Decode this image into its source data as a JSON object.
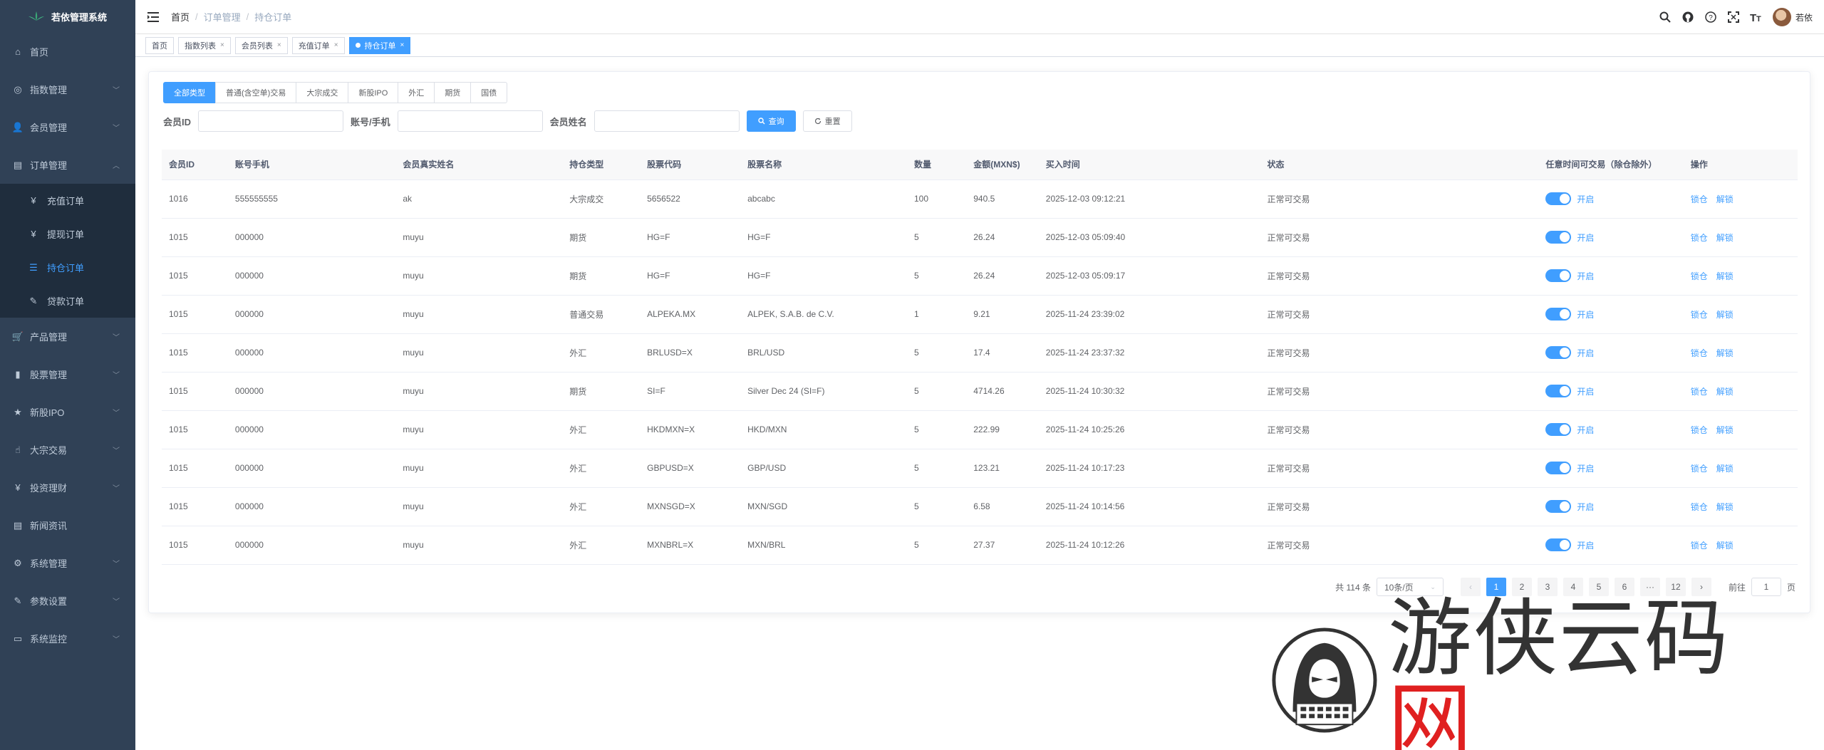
{
  "app": {
    "title": "若依管理系统"
  },
  "sidebar": {
    "items": [
      {
        "label": "首页",
        "icon": "dashboard-icon",
        "glyph": "⌂",
        "has_children": false
      },
      {
        "label": "指数管理",
        "icon": "index-icon",
        "glyph": "◎",
        "has_children": true
      },
      {
        "label": "会员管理",
        "icon": "user-icon",
        "glyph": "👤",
        "has_children": true
      },
      {
        "label": "订单管理",
        "icon": "order-icon",
        "glyph": "▤",
        "has_children": true,
        "expanded": true,
        "children": [
          {
            "label": "充值订单",
            "icon": "yen-icon",
            "glyph": "¥"
          },
          {
            "label": "提现订单",
            "icon": "yen-icon",
            "glyph": "¥"
          },
          {
            "label": "持仓订单",
            "icon": "list-icon",
            "glyph": "☰",
            "active": true
          },
          {
            "label": "贷款订单",
            "icon": "edit-icon",
            "glyph": "✎"
          }
        ]
      },
      {
        "label": "产品管理",
        "icon": "cart-icon",
        "glyph": "🛒",
        "has_children": true
      },
      {
        "label": "股票管理",
        "icon": "chart-icon",
        "glyph": "▮",
        "has_children": true
      },
      {
        "label": "新股IPO",
        "icon": "star-icon",
        "glyph": "★",
        "has_children": true
      },
      {
        "label": "大宗交易",
        "icon": "thumb-icon",
        "glyph": "☝",
        "has_children": true
      },
      {
        "label": "投资理财",
        "icon": "yen-icon",
        "glyph": "¥",
        "has_children": true
      },
      {
        "label": "新闻资讯",
        "icon": "news-icon",
        "glyph": "▤",
        "has_children": false
      },
      {
        "label": "系统管理",
        "icon": "gear-icon",
        "glyph": "⚙",
        "has_children": true
      },
      {
        "label": "参数设置",
        "icon": "edit-icon",
        "glyph": "✎",
        "has_children": true
      },
      {
        "label": "系统监控",
        "icon": "monitor-icon",
        "glyph": "▭",
        "has_children": true
      }
    ]
  },
  "breadcrumb": [
    "首页",
    "订单管理",
    "持仓订单"
  ],
  "navbar": {
    "username": "若依"
  },
  "tags": [
    {
      "label": "首页",
      "closable": false,
      "active": false
    },
    {
      "label": "指数列表",
      "closable": true,
      "active": false
    },
    {
      "label": "会员列表",
      "closable": true,
      "active": false
    },
    {
      "label": "充值订单",
      "closable": true,
      "active": false
    },
    {
      "label": "持仓订单",
      "closable": true,
      "active": true
    }
  ],
  "type_tabs": [
    "全部类型",
    "普通(含空单)交易",
    "大宗成交",
    "新股IPO",
    "外汇",
    "期货",
    "国债"
  ],
  "filters": {
    "member_id_label": "会员ID",
    "account_label": "账号/手机",
    "name_label": "会员姓名",
    "search_btn": "查询",
    "reset_btn": "重置"
  },
  "table": {
    "headers": [
      "会员ID",
      "账号手机",
      "会员真实姓名",
      "持仓类型",
      "股票代码",
      "股票名称",
      "数量",
      "金额(MXN$)",
      "买入时间",
      "状态",
      "任意时间可交易（除仓除外）",
      "操作"
    ],
    "switch_label": "开启",
    "op_close": "锁仓",
    "op_unlock": "解锁",
    "rows": [
      [
        "1016",
        "555555555",
        "ak",
        "大宗成交",
        "5656522",
        "abcabc",
        "100",
        "940.5",
        "2025-12-03 09:12:21",
        "正常可交易"
      ],
      [
        "1015",
        "000000",
        "muyu",
        "期货",
        "HG=F",
        "HG=F",
        "5",
        "26.24",
        "2025-12-03 05:09:40",
        "正常可交易"
      ],
      [
        "1015",
        "000000",
        "muyu",
        "期货",
        "HG=F",
        "HG=F",
        "5",
        "26.24",
        "2025-12-03 05:09:17",
        "正常可交易"
      ],
      [
        "1015",
        "000000",
        "muyu",
        "普通交易",
        "ALPEKA.MX",
        "ALPEK, S.A.B. de C.V.",
        "1",
        "9.21",
        "2025-11-24 23:39:02",
        "正常可交易"
      ],
      [
        "1015",
        "000000",
        "muyu",
        "外汇",
        "BRLUSD=X",
        "BRL/USD",
        "5",
        "17.4",
        "2025-11-24 23:37:32",
        "正常可交易"
      ],
      [
        "1015",
        "000000",
        "muyu",
        "期货",
        "SI=F",
        "Silver Dec 24 (SI=F)",
        "5",
        "4714.26",
        "2025-11-24 10:30:32",
        "正常可交易"
      ],
      [
        "1015",
        "000000",
        "muyu",
        "外汇",
        "HKDMXN=X",
        "HKD/MXN",
        "5",
        "222.99",
        "2025-11-24 10:25:26",
        "正常可交易"
      ],
      [
        "1015",
        "000000",
        "muyu",
        "外汇",
        "GBPUSD=X",
        "GBP/USD",
        "5",
        "123.21",
        "2025-11-24 10:17:23",
        "正常可交易"
      ],
      [
        "1015",
        "000000",
        "muyu",
        "外汇",
        "MXNSGD=X",
        "MXN/SGD",
        "5",
        "6.58",
        "2025-11-24 10:14:56",
        "正常可交易"
      ],
      [
        "1015",
        "000000",
        "muyu",
        "外汇",
        "MXNBRL=X",
        "MXN/BRL",
        "5",
        "27.37",
        "2025-11-24 10:12:26",
        "正常可交易"
      ]
    ]
  },
  "pagination": {
    "total_text": "共 114 条",
    "page_size": "10条/页",
    "pages": [
      "1",
      "2",
      "3",
      "4",
      "5",
      "6",
      "···",
      "12"
    ],
    "current": "1",
    "goto_label": "前往",
    "goto_value": "1",
    "page_unit": "页"
  },
  "watermark": {
    "text_main": "游侠云码",
    "text_red": "网"
  },
  "colors": {
    "sidebar_bg": "#304156",
    "primary": "#409eff",
    "submenu_bg": "#1f2d3d"
  }
}
